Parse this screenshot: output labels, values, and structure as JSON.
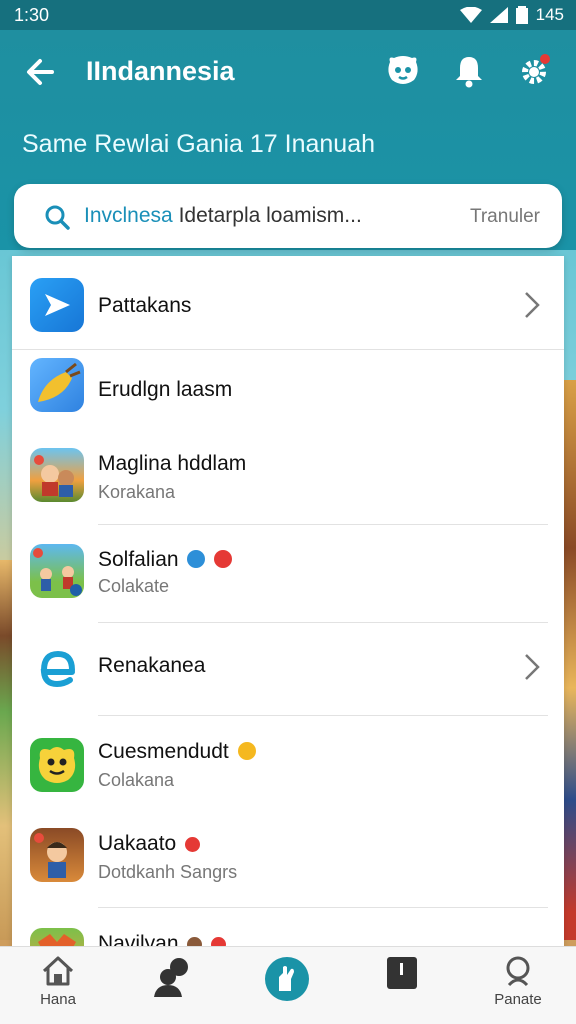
{
  "status": {
    "time": "1:30",
    "battery": "145"
  },
  "header": {
    "title": "IIndannesia",
    "subtitle": "Same Rewlai Gania 17 Inanuah"
  },
  "search": {
    "query_highlight": "Invclnesa",
    "query_rest": "Idetarpla loamism...",
    "filter_label": "Tranuler"
  },
  "list": {
    "items": [
      {
        "title": "Pattakans",
        "subtitle": ""
      },
      {
        "title": "Erudlgn laasm",
        "subtitle": ""
      },
      {
        "title": "Maglina hddlam",
        "subtitle": "Korakana"
      },
      {
        "title": "Solfalian",
        "subtitle": "Colakate"
      },
      {
        "title": "Renakanea",
        "subtitle": ""
      },
      {
        "title": "Cuesmendudt",
        "subtitle": "Colakana"
      },
      {
        "title": "Uakaato",
        "subtitle": "Dotdkanh Sangrs"
      },
      {
        "title": "Navilyan",
        "subtitle": ""
      }
    ]
  },
  "nav": {
    "home": "Hana",
    "search": "Panate"
  },
  "colors": {
    "header": "#1a93a7",
    "statusbar": "#16707e",
    "accent": "#1a8fb8"
  }
}
